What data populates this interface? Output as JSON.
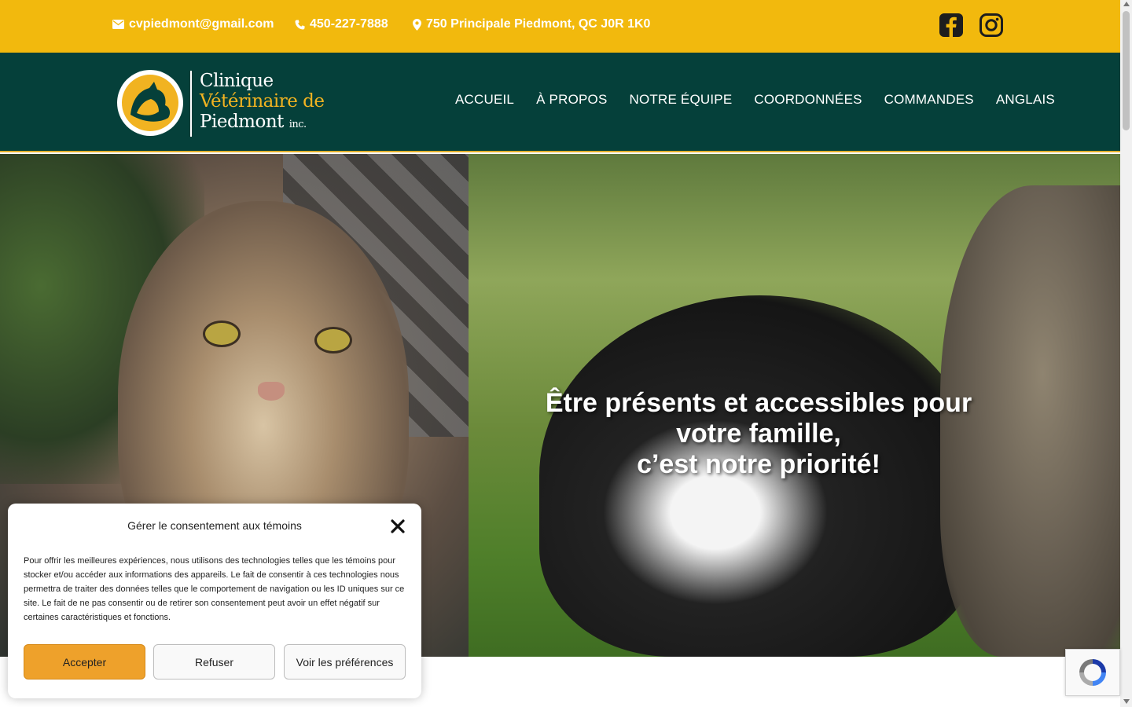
{
  "topbar": {
    "email": "cvpiedmont@gmail.com",
    "phone": "450-227-7888",
    "address": "750 Principale Piedmont, QC J0R 1K0",
    "accent_color": "#f2b90d",
    "social": [
      "facebook-icon",
      "instagram-icon"
    ]
  },
  "nav": {
    "logo": {
      "line1": "Clinique",
      "line2": "Vétérinaire de",
      "line3": "Piedmont",
      "suffix": "inc."
    },
    "items": [
      {
        "label": "ACCUEIL"
      },
      {
        "label": "À PROPOS"
      },
      {
        "label": "NOTRE ÉQUIPE"
      },
      {
        "label": "COORDONNÉES"
      },
      {
        "label": "COMMANDES"
      },
      {
        "label": "ANGLAIS"
      }
    ],
    "background": "#05403a"
  },
  "hero": {
    "title_line1": "Être présents et accessibles pour",
    "title_line2": "votre famille,",
    "title_line3": "c’est notre priorité!"
  },
  "cookie": {
    "title": "Gérer le consentement aux témoins",
    "body": "Pour offrir les meilleures expériences, nous utilisons des technologies telles que les témoins pour stocker et/ou accéder aux informations des appareils. Le fait de consentir à ces technologies nous permettra de traiter des données telles que le comportement de navigation ou les ID uniques sur ce site. Le fait de ne pas consentir ou de retirer son consentement peut avoir un effet négatif sur certaines caractéristiques et fonctions.",
    "accept": "Accepter",
    "refuse": "Refuser",
    "preferences": "Voir les préférences",
    "accept_color": "#eea12b"
  }
}
